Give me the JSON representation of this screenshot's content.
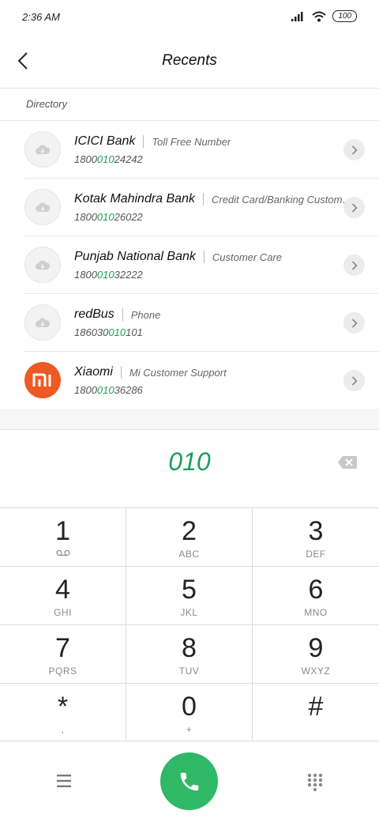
{
  "status": {
    "time": "2:36 AM",
    "battery": "100"
  },
  "header": {
    "title": "Recents"
  },
  "section": {
    "label": "Directory"
  },
  "contacts": [
    {
      "name": "ICICI Bank",
      "desc": "Toll Free Number",
      "num_pre": "1800",
      "num_hl": "010",
      "num_post": "24242",
      "avatar": "cloud-icon"
    },
    {
      "name": "Kotak Mahindra Bank",
      "desc": "Credit Card/Banking Customer Serv...",
      "num_pre": "1800",
      "num_hl": "010",
      "num_post": "26022",
      "avatar": "cloud-icon"
    },
    {
      "name": "Punjab National Bank",
      "desc": "Customer Care",
      "num_pre": "1800",
      "num_hl": "010",
      "num_post": "32222",
      "avatar": "cloud-icon"
    },
    {
      "name": "redBus",
      "desc": "Phone",
      "num_pre": "186030",
      "num_hl": "010",
      "num_post": "101",
      "avatar": "cloud-icon"
    },
    {
      "name": "Xiaomi",
      "desc": "Mi Customer Support",
      "num_pre": "1800",
      "num_hl": "010",
      "num_post": "36286",
      "avatar": "mi-logo"
    }
  ],
  "dialer": {
    "digits": "010"
  },
  "keypad": [
    {
      "digit": "1",
      "sub": ""
    },
    {
      "digit": "2",
      "sub": "ABC"
    },
    {
      "digit": "3",
      "sub": "DEF"
    },
    {
      "digit": "4",
      "sub": "GHI"
    },
    {
      "digit": "5",
      "sub": "JKL"
    },
    {
      "digit": "6",
      "sub": "MNO"
    },
    {
      "digit": "7",
      "sub": "PQRS"
    },
    {
      "digit": "8",
      "sub": "TUV"
    },
    {
      "digit": "9",
      "sub": "WXYZ"
    },
    {
      "digit": "*",
      "sub": ","
    },
    {
      "digit": "0",
      "sub": "+"
    },
    {
      "digit": "#",
      "sub": ""
    }
  ],
  "colors": {
    "accent": "#1e9e5c",
    "call": "#2fb865",
    "mi_brand": "#ee5a24"
  },
  "icons": {
    "back": "back-arrow-icon",
    "backspace": "backspace-icon",
    "menu": "menu-icon",
    "call": "phone-icon",
    "dialpad": "dialpad-icon",
    "voicemail": "voicemail-icon"
  }
}
